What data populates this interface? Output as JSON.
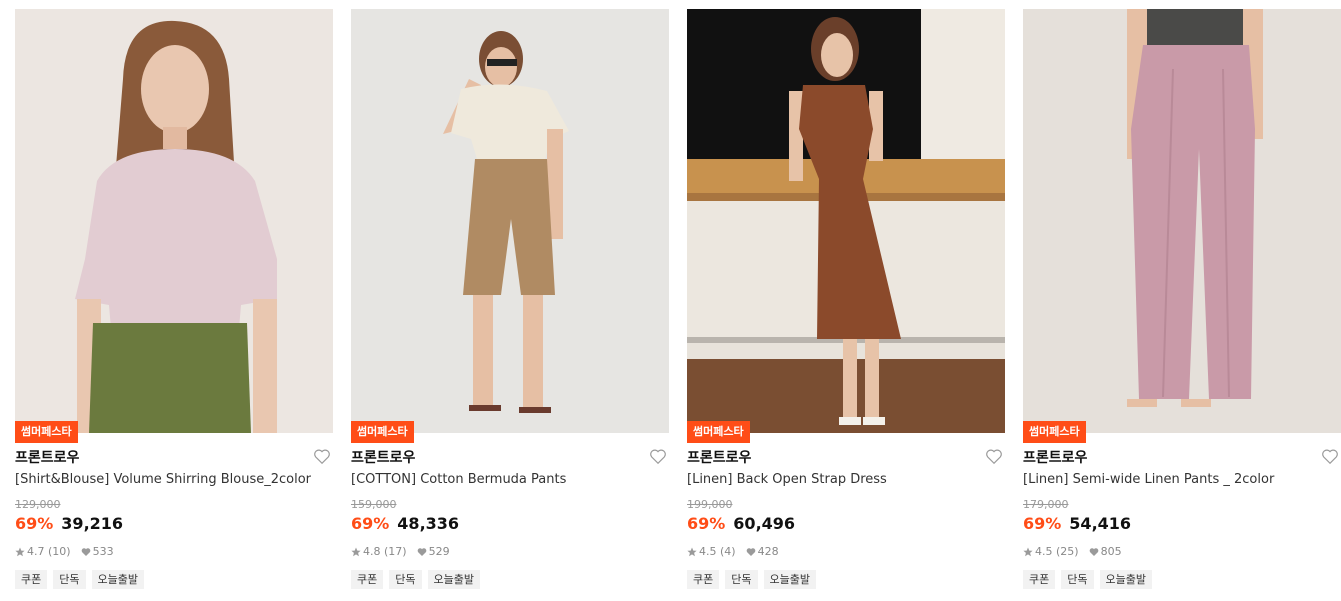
{
  "products": [
    {
      "badge": "썸머페스타",
      "brand": "프론트로우",
      "name": "[Shirt&Blouse] Volume Shirring Blouse_2color",
      "original_price": "129,000",
      "discount": "69%",
      "price": "39,216",
      "rating": "4.7",
      "reviews": "(10)",
      "likes": "533",
      "tags": [
        "쿠폰",
        "단독",
        "오늘출발"
      ],
      "photo_icon": "blouse-model-photo",
      "colors": {
        "bg": "#ece6e1",
        "top": "#e2ccd2",
        "bottom": "#6b7a3e",
        "hair": "#8a5a3a",
        "skin": "#e9c7b0"
      }
    },
    {
      "badge": "썸머페스타",
      "brand": "프론트로우",
      "name": "[COTTON] Cotton Bermuda Pants",
      "original_price": "159,000",
      "discount": "69%",
      "price": "48,336",
      "rating": "4.8",
      "reviews": "(17)",
      "likes": "529",
      "tags": [
        "쿠폰",
        "단독",
        "오늘출발"
      ],
      "photo_icon": "bermuda-pants-model-photo",
      "colors": {
        "bg": "#e6e5e2",
        "top": "#efe9dc",
        "bottom": "#b08b63",
        "hair": "#7a4e34",
        "skin": "#e6bfa4"
      }
    },
    {
      "badge": "썸머페스타",
      "brand": "프론트로우",
      "name": "[Linen] Back Open Strap Dress",
      "original_price": "199,000",
      "discount": "69%",
      "price": "60,496",
      "rating": "4.5",
      "reviews": "(4)",
      "likes": "428",
      "tags": [
        "쿠폰",
        "단독",
        "오늘출발"
      ],
      "photo_icon": "strap-dress-model-photo",
      "colors": {
        "bg": "#e8e3db",
        "top": "#8b4a2b",
        "bottom": "#8b4a2b",
        "hair": "#6a3f2a",
        "skin": "#e7c3a8"
      }
    },
    {
      "badge": "썸머페스타",
      "brand": "프론트로우",
      "name": "[Linen] Semi-wide Linen Pants _ 2color",
      "original_price": "179,000",
      "discount": "69%",
      "price": "54,416",
      "rating": "4.5",
      "reviews": "(25)",
      "likes": "805",
      "tags": [
        "쿠폰",
        "단독",
        "오늘출발"
      ],
      "photo_icon": "linen-pants-model-photo",
      "colors": {
        "bg": "#e5e0da",
        "top": "#4a4a48",
        "bottom": "#c99aa8",
        "hair": "#6a3f2a",
        "skin": "#e6bfa4"
      }
    }
  ]
}
